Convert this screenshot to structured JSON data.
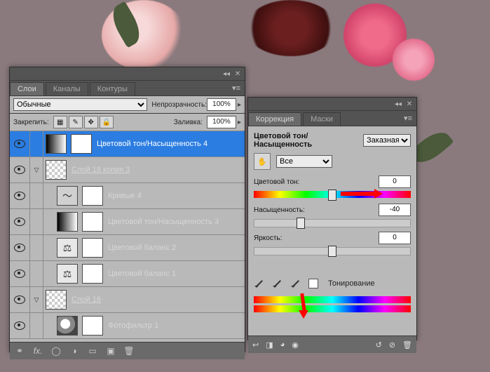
{
  "layers_panel": {
    "tabs": {
      "layers": "Слои",
      "channels": "Каналы",
      "paths": "Контуры"
    },
    "blend_mode": "Обычные",
    "opacity_label": "Непрозрачность:",
    "opacity_value": "100%",
    "lock_label": "Закрепить:",
    "fill_label": "Заливка:",
    "fill_value": "100%",
    "layers": [
      {
        "name": "Цветовой тон/Насыщенность 4",
        "selected": true,
        "thumb": "gradient"
      },
      {
        "name": "Слой 18 копия 3",
        "thumb": "checker",
        "underline": true
      },
      {
        "name": "Кривые 4",
        "thumb": "curves",
        "indent": 1
      },
      {
        "name": "Цветовой тон/Насыщенность 3",
        "thumb": "gradient",
        "indent": 1
      },
      {
        "name": "Цветовой баланс 2",
        "thumb": "balance",
        "indent": 1
      },
      {
        "name": "Цветовой баланс 1",
        "thumb": "balance",
        "indent": 1
      },
      {
        "name": "Слой 16",
        "thumb": "checker",
        "underline": true
      },
      {
        "name": "Фотофильтр 1",
        "thumb": "photo-filter",
        "indent": 1
      }
    ]
  },
  "adjust_panel": {
    "tabs": {
      "adjustments": "Коррекция",
      "masks": "Маски"
    },
    "title": "Цветовой тон/Насыщенность",
    "preset": "Заказная",
    "range": "Все",
    "hue": {
      "label": "Цветовой тон:",
      "value": "0"
    },
    "sat": {
      "label": "Насыщенность:",
      "value": "-40"
    },
    "light": {
      "label": "Яркость:",
      "value": "0"
    },
    "colorize_label": "Тонирование"
  }
}
